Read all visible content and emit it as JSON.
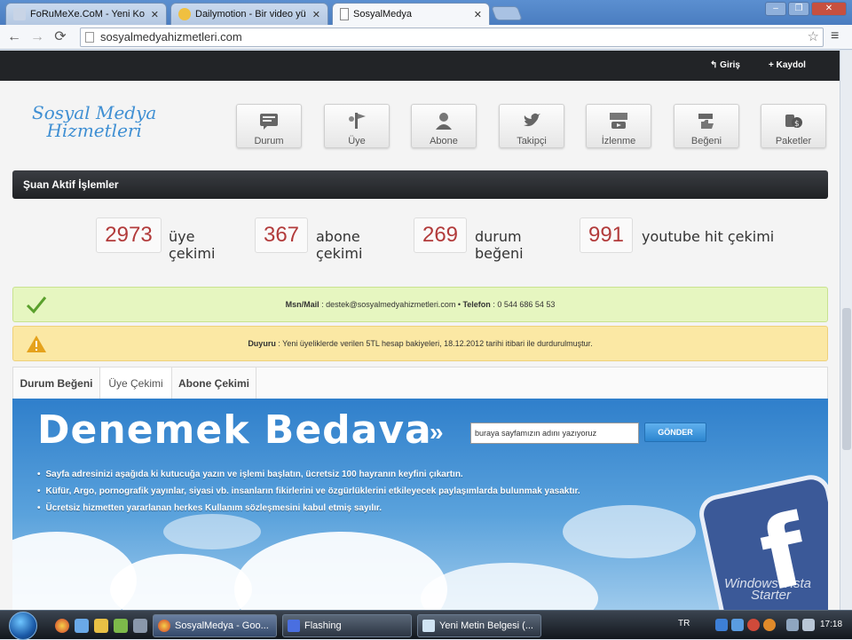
{
  "browser": {
    "tabs": [
      {
        "label": "FoRuMeXe.CoM - Yeni Ko",
        "icon": "forum-favicon"
      },
      {
        "label": "Dailymotion - Bir video yü",
        "icon": "dailymotion-favicon"
      },
      {
        "label": "SosyalMedya",
        "icon": "page-favicon",
        "active": true
      }
    ],
    "url": "sosyalmedyahizmetleri.com"
  },
  "site": {
    "topbar": {
      "login": "Giriş",
      "register": "Kaydol"
    },
    "logo": {
      "line1": "Sosyal Medya",
      "line2": "Hizmetleri"
    },
    "nav": [
      {
        "label": "Durum",
        "icon": "status-icon"
      },
      {
        "label": "Üye",
        "icon": "member-icon"
      },
      {
        "label": "Abone",
        "icon": "subscriber-icon"
      },
      {
        "label": "Takipçi",
        "icon": "twitter-icon"
      },
      {
        "label": "İzlenme",
        "icon": "youtube-icon"
      },
      {
        "label": "Beğeni",
        "icon": "like-icon"
      },
      {
        "label": "Paketler",
        "icon": "packages-icon"
      }
    ],
    "section_title": "Şuan Aktif İşlemler",
    "stats": [
      {
        "value": "2973",
        "label1": "üye",
        "label2": "çekimi"
      },
      {
        "value": "367",
        "label1": "abone",
        "label2": "çekimi"
      },
      {
        "value": "269",
        "label1": "durum",
        "label2": "beğeni"
      },
      {
        "value": "991",
        "label1": "youtube hit çekimi",
        "label2": ""
      }
    ],
    "contact": {
      "label1": "Msn/Mail",
      "text1": " : destek@sosyalmedyahizmetleri.com • ",
      "label2": "Telefon",
      "text2": " : 0 544 686 54 53"
    },
    "announcement": {
      "label": "Duyuru",
      "text": " : Yeni üyeliklerde verilen 5TL hesap bakiyeleri, 18.12.2012 tarihi itibari ile durdurulmuştur."
    },
    "tabs": [
      "Durum Beğeni",
      "Üye Çekimi",
      "Abone Çekimi"
    ],
    "active_tab": "Üye Çekimi",
    "hero": {
      "title": "Denemek Bedava",
      "arrow": "»",
      "input_value": "buraya sayfamızın adını yazıyoruz",
      "send_button": "GÖNDER",
      "bullets": [
        "Sayfa adresinizi aşağıda ki kutucuğa yazın ve işlemi başlatın, ücretsiz 100 hayranın keyfini çıkartın.",
        "Küfür, Argo, pornografik yayınlar, siyasi vb. insanların fikirlerini ve özgürlüklerini etkileyecek paylaşımlarda bulunmak yasaktır.",
        "Ücretsiz hizmetten yararlanan herkes Kullanım sözleşmesini kabul etmiş sayılır."
      ],
      "fb_letter": "f",
      "watermark": {
        "line1": "Windows Vista",
        "line2": "Starter"
      }
    }
  },
  "taskbar": {
    "buttons": [
      {
        "label": "SosyalMedya - Goo...",
        "icon": "chrome-icon",
        "active": true
      },
      {
        "label": "Flashing",
        "icon": "flashing-icon"
      },
      {
        "label": "Yeni Metin Belgesi (...",
        "icon": "notepad-icon"
      }
    ],
    "lang": "TR",
    "clock": "17:18"
  },
  "colors": {
    "accent": "#3f8fd3",
    "stat_number": "#b23b3b",
    "topbar": "#222427"
  }
}
